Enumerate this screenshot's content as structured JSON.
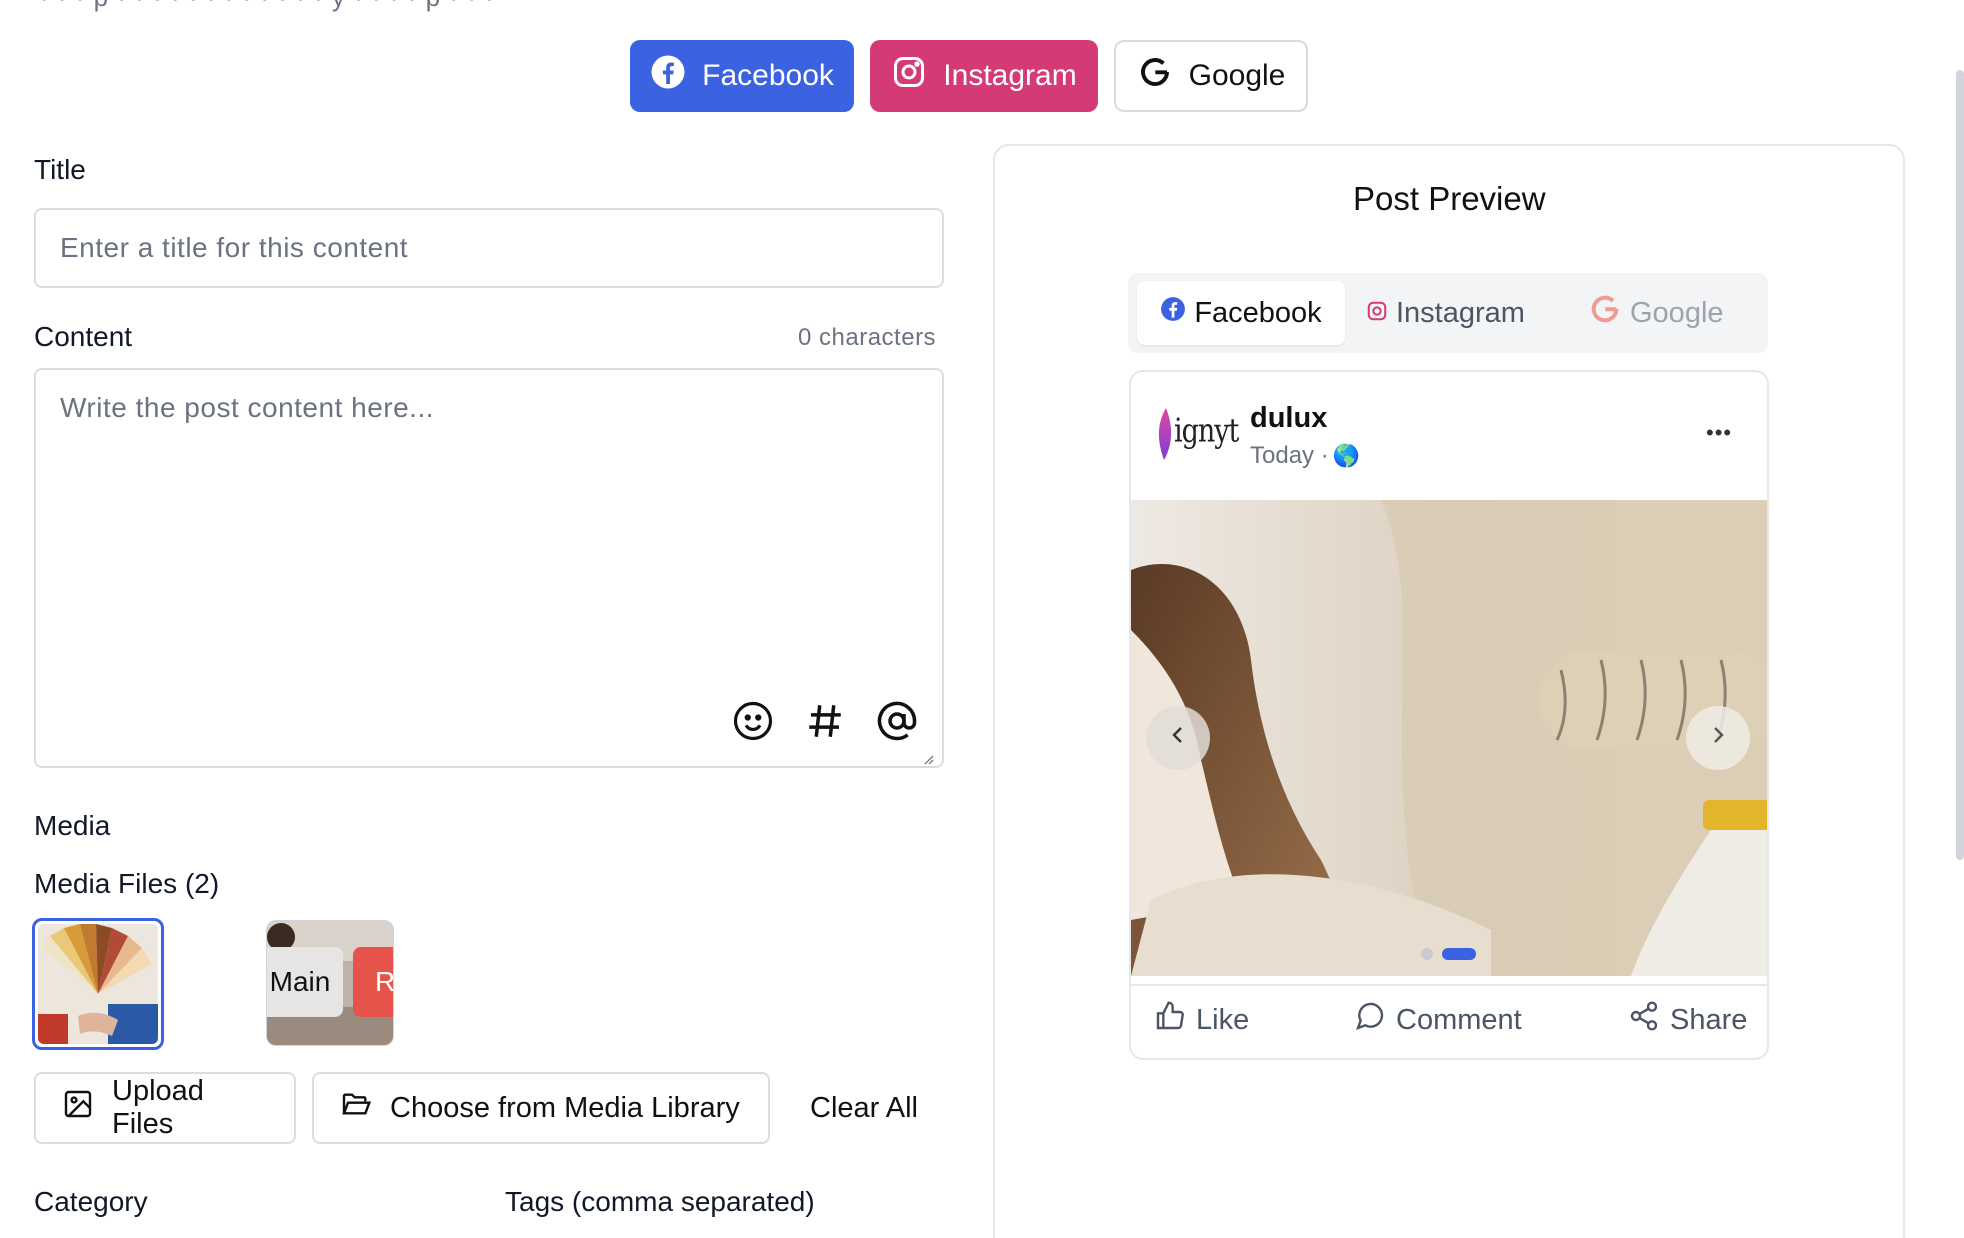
{
  "header_hint": "· · ·  p · · · ·  · · · · · · · ·  y  · ·  · ·  p · · ·",
  "platforms": [
    {
      "label": "Facebook",
      "icon": "facebook-icon",
      "color": "#3b62e0"
    },
    {
      "label": "Instagram",
      "icon": "instagram-icon",
      "color": "#d43b76"
    },
    {
      "label": "Google",
      "icon": "google-icon",
      "color": "#ffffff"
    }
  ],
  "form": {
    "title_label": "Title",
    "title_placeholder": "Enter a title for this content",
    "content_label": "Content",
    "char_count": "0 characters",
    "content_placeholder": "Write the post content here...",
    "tools": [
      "emoji-icon",
      "hashtag-icon",
      "mention-icon"
    ],
    "media_label": "Media",
    "media_files_label": "Media Files (2)",
    "thumb2_overlay_main": "Main",
    "thumb2_overlay_r": "R",
    "upload_label": "Upload Files",
    "library_label": "Choose from Media Library",
    "clear_label": "Clear All",
    "category_label": "Category",
    "tags_label": "Tags (comma separated)"
  },
  "preview": {
    "title": "Post Preview",
    "tabs": [
      "Facebook",
      "Instagram",
      "Google"
    ],
    "active_tab": "Facebook",
    "account_name": "dulux",
    "logo_text": "ignyt",
    "post_time": "Today · ",
    "globe": "🌎",
    "more": "•••",
    "reactions": [
      "Like",
      "Comment",
      "Share"
    ],
    "carousel_count": 2,
    "carousel_active": 1,
    "accent": "#3b62e0"
  }
}
